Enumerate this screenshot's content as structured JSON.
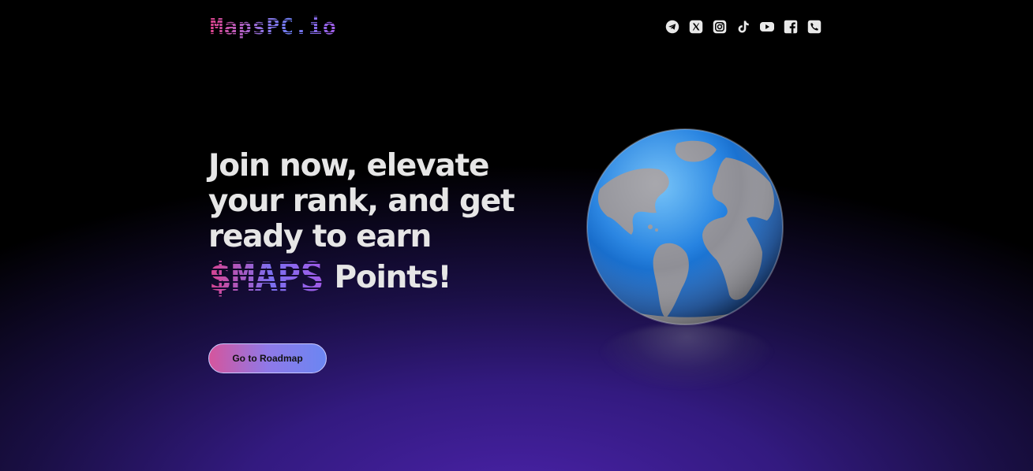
{
  "header": {
    "logo_text": "MapsPC.io",
    "socials": [
      {
        "icon": "telegram-icon",
        "label": "Telegram"
      },
      {
        "icon": "x-twitter-icon",
        "label": "X"
      },
      {
        "icon": "instagram-icon",
        "label": "Instagram"
      },
      {
        "icon": "tiktok-icon",
        "label": "TikTok"
      },
      {
        "icon": "youtube-icon",
        "label": "YouTube"
      },
      {
        "icon": "facebook-icon",
        "label": "Facebook"
      },
      {
        "icon": "phone-icon",
        "label": "Phone"
      }
    ]
  },
  "hero": {
    "headline_line1": "Join now, elevate",
    "headline_line2": "your rank, and get",
    "headline_line3": "ready to earn",
    "token_text": "$MAPS",
    "points_text": "Points!",
    "cta_label": "Go to Roadmap"
  },
  "colors": {
    "background": "#000000",
    "glow_purple": "#4a22a8",
    "gradient_pink": "#d9438f",
    "gradient_blue": "#6b86f2",
    "gradient_violet": "#a15ae6",
    "text_light": "#e6e6e6"
  },
  "illustration": {
    "icon": "globe-icon"
  }
}
